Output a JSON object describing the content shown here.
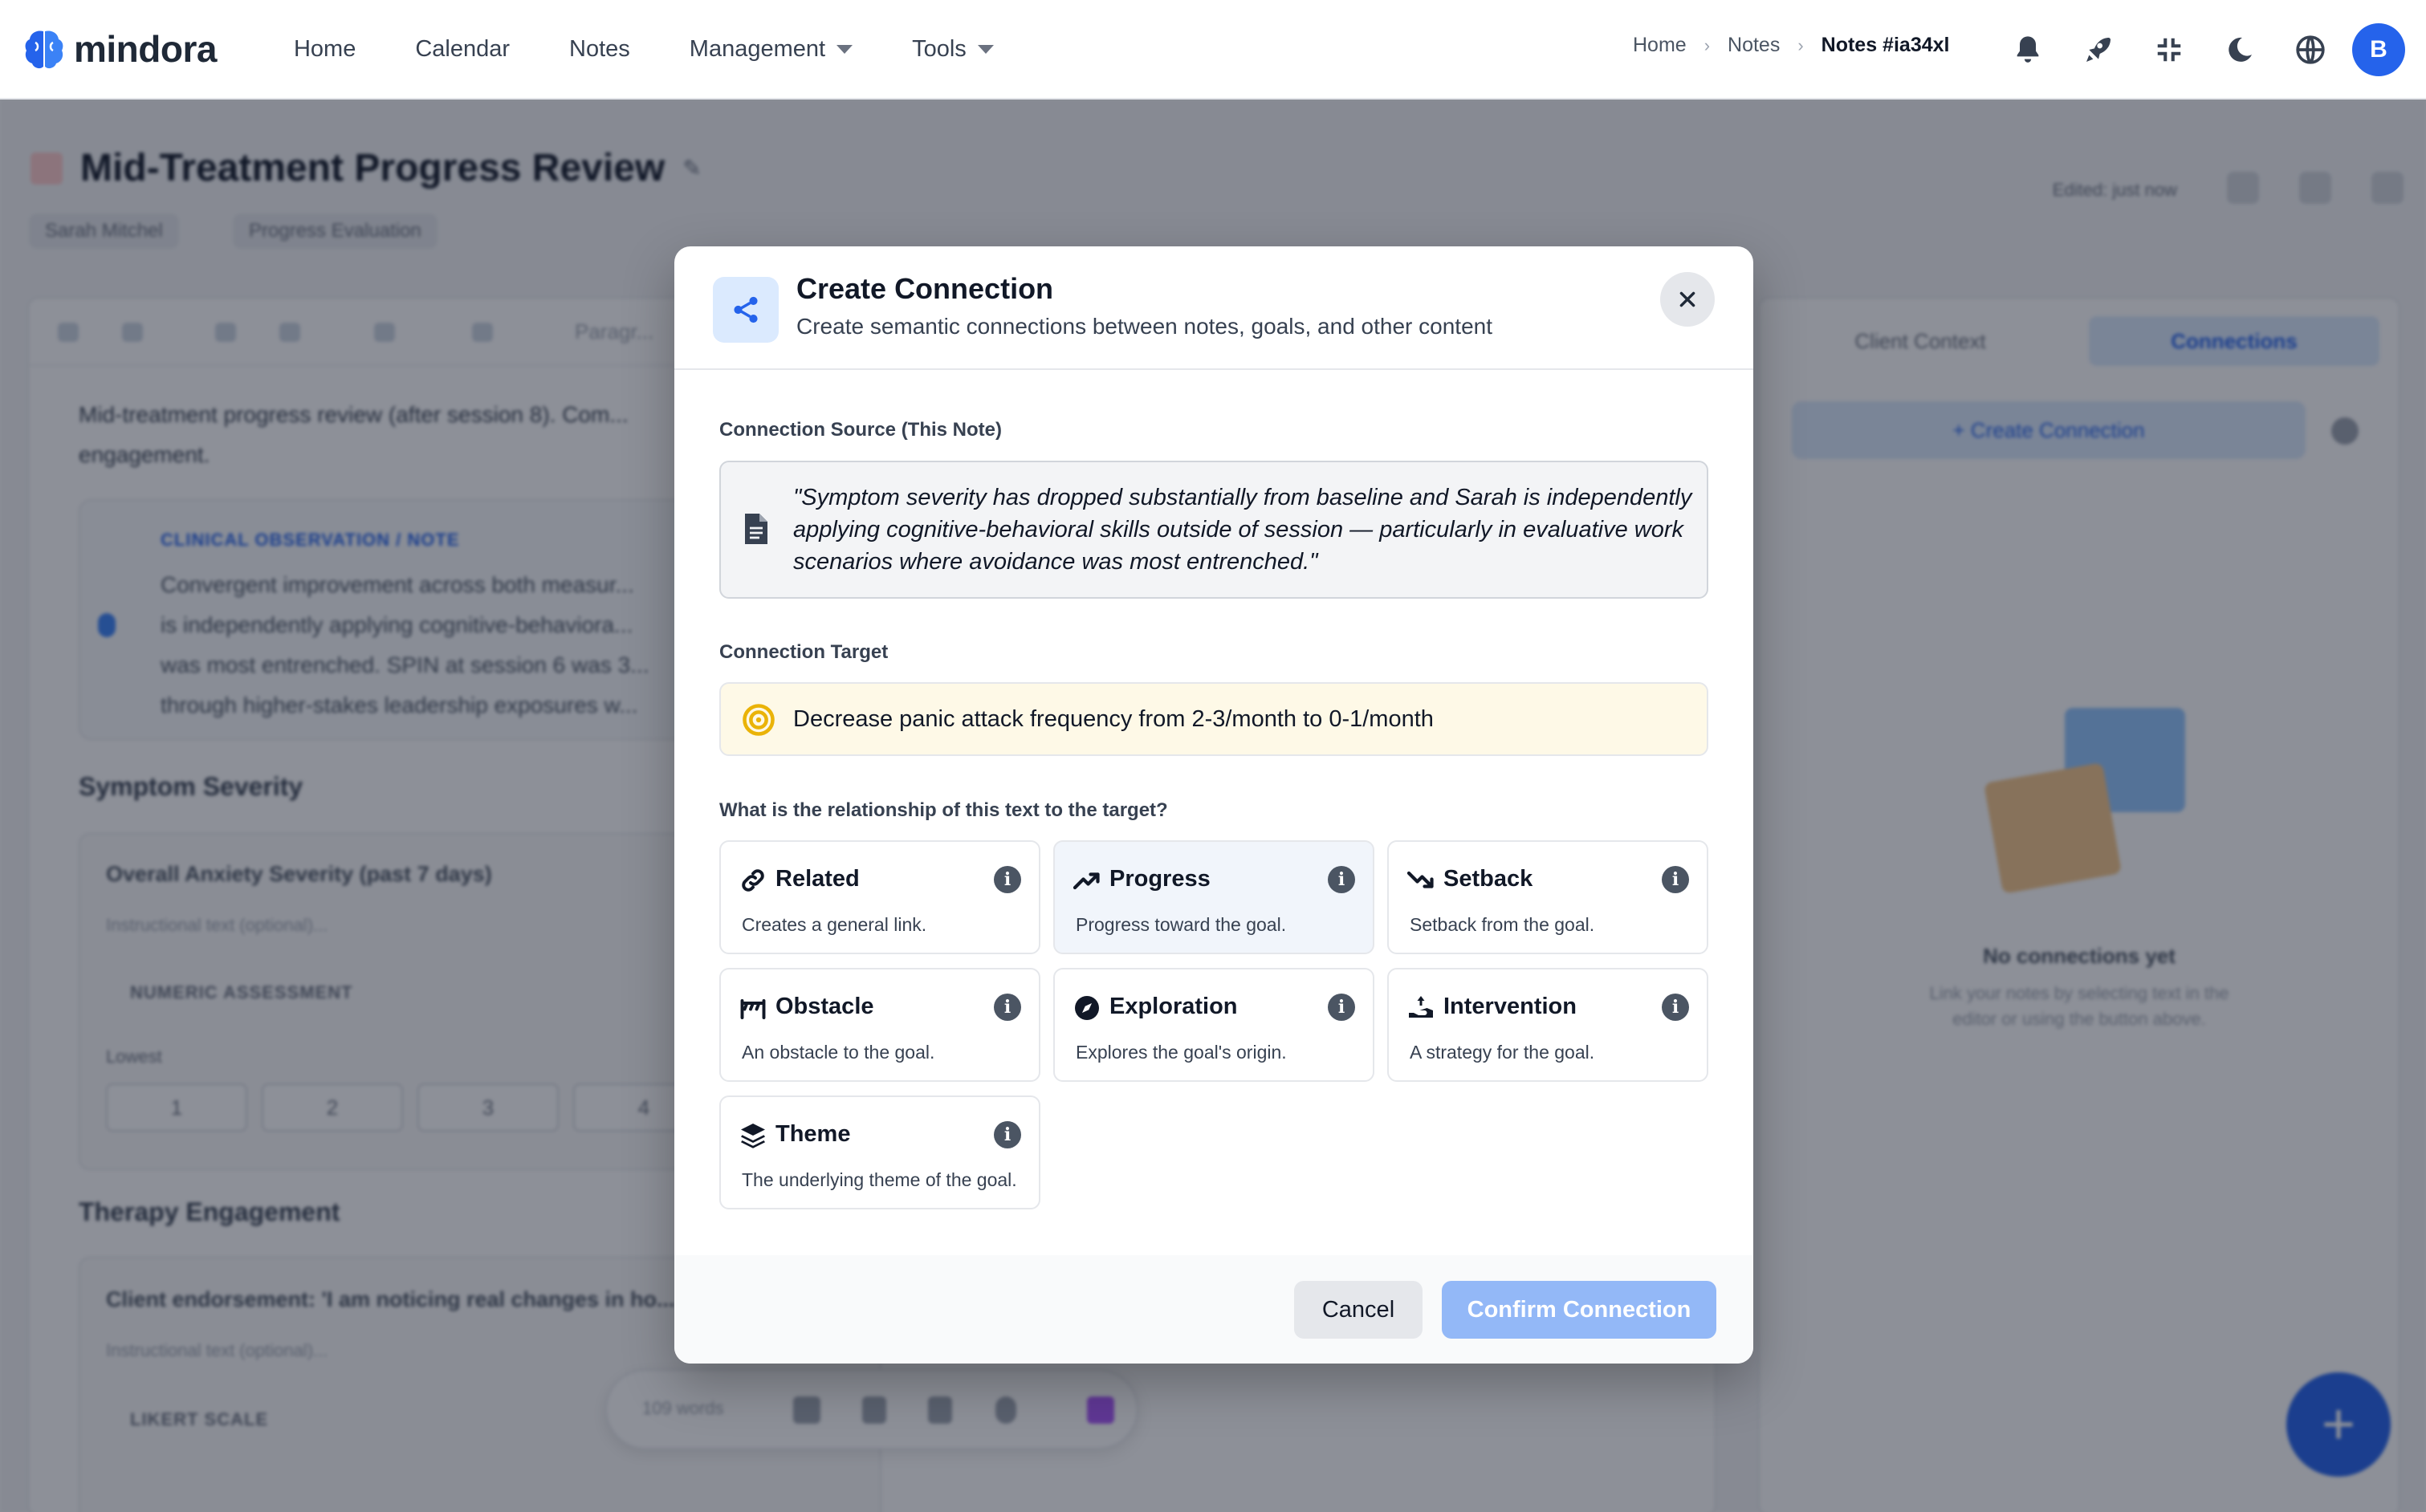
{
  "brand": {
    "name": "mindora",
    "accent": "#2563eb"
  },
  "nav": {
    "links": [
      {
        "label": "Home",
        "dropdown": false
      },
      {
        "label": "Calendar",
        "dropdown": false
      },
      {
        "label": "Notes",
        "dropdown": false
      },
      {
        "label": "Management",
        "dropdown": true
      },
      {
        "label": "Tools",
        "dropdown": true
      }
    ],
    "breadcrumb": [
      "Home",
      "Notes",
      "Notes #ia34xl"
    ],
    "icons": [
      "bell-icon",
      "rocket-icon",
      "compress-icon",
      "moon-icon",
      "globe-icon"
    ],
    "avatar_initial": "B"
  },
  "background_page": {
    "title": "Mid-Treatment Progress Review",
    "chips": [
      "Sarah Mitchel",
      "Progress Evaluation"
    ],
    "edited": "Edited: just now",
    "toolbar_paragraph": "Paragr...",
    "intro_text": "Mid-treatment progress review (after session 8). Com...",
    "intro_text_2": "engagement.",
    "observation_label": "CLINICAL OBSERVATION / NOTE",
    "observation_lines": [
      "Convergent improvement across both measur...",
      "is independently applying cognitive-behaviora...",
      "was most entrenched. SPIN at session 6 was 3...",
      "through higher-stakes leadership exposures w..."
    ],
    "section_symptom": "Symptom Severity",
    "question_1": "Overall Anxiety Severity (past 7 days)",
    "instruction_placeholder": "Instructional text (optional)...",
    "numeric_label": "NUMERIC ASSESSMENT",
    "lowest_label": "Lowest",
    "scale": [
      "1",
      "2",
      "3",
      "4"
    ],
    "section_engagement": "Therapy Engagement",
    "question_2": "Client endorsement: 'I am noticing real changes in ho...",
    "likert_label": "LIKERT SCALE",
    "word_count": "109 words",
    "right_tabs": [
      "Client Context",
      "Connections"
    ],
    "create_connection": "+ Create Connection",
    "empty_title": "No connections yet",
    "empty_text": "Link your notes by selecting text in the editor or using the button above."
  },
  "modal": {
    "title": "Create Connection",
    "subtitle": "Create semantic connections between notes, goals, and other content",
    "source_label": "Connection Source (This Note)",
    "source_text": "\"Symptom severity has dropped substantially from baseline and Sarah is independently applying cognitive-behavioral skills outside of session — particularly in evaluative work scenarios where avoidance was most entrenched.\"",
    "target_label": "Connection Target",
    "target_text": "Decrease panic attack frequency from 2-3/month to 0-1/month",
    "relationship_question": "What is the relationship of this text to the target?",
    "options": [
      {
        "title": "Related",
        "desc": "Creates a general link.",
        "icon": "link-icon",
        "selected": false
      },
      {
        "title": "Progress",
        "desc": "Progress toward the goal.",
        "icon": "trending-up-icon",
        "selected": true
      },
      {
        "title": "Setback",
        "desc": "Setback from the goal.",
        "icon": "trending-down-icon",
        "selected": false
      },
      {
        "title": "Obstacle",
        "desc": "An obstacle to the goal.",
        "icon": "barrier-icon",
        "selected": false
      },
      {
        "title": "Exploration",
        "desc": "Explores the goal's origin.",
        "icon": "compass-icon",
        "selected": false
      },
      {
        "title": "Intervention",
        "desc": "A strategy for the goal.",
        "icon": "hand-holding-icon",
        "selected": false
      },
      {
        "title": "Theme",
        "desc": "The underlying theme of the goal.",
        "icon": "layers-icon",
        "selected": false
      }
    ],
    "cancel_label": "Cancel",
    "confirm_label": "Confirm Connection"
  }
}
